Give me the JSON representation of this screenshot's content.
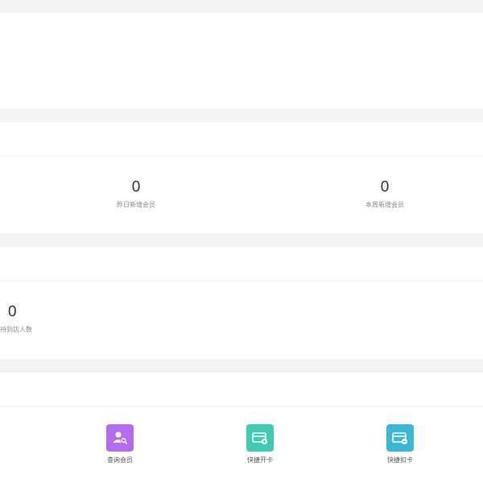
{
  "stats_row1": [
    {
      "value": "0",
      "label": "昨日新增会员"
    },
    {
      "value": "0",
      "label": "本周新增会员"
    }
  ],
  "stats_row2": [
    {
      "value": "0",
      "label": "待到店人数"
    }
  ],
  "quick_actions": [
    {
      "label": "查询会员",
      "icon": "member-search-icon",
      "color": "#b36cf0"
    },
    {
      "label": "快捷开卡",
      "icon": "open-card-icon",
      "color": "#3fcab2"
    },
    {
      "label": "快捷扣卡",
      "icon": "deduct-card-icon",
      "color": "#3ab8d6"
    }
  ]
}
